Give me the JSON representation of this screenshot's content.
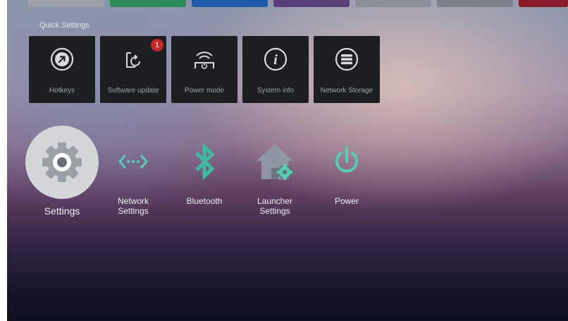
{
  "quick_settings": {
    "title": "Quick Settings",
    "tiles": [
      {
        "label": "Hotkeys",
        "icon": "arrow-up-right-circle-icon"
      },
      {
        "label": "Software update",
        "icon": "update-icon",
        "badge": "1"
      },
      {
        "label": "Power mode",
        "icon": "power-mode-icon"
      },
      {
        "label": "System info",
        "icon": "info-icon"
      },
      {
        "label": "Network Storage",
        "icon": "storage-icon"
      }
    ]
  },
  "apps": [
    {
      "label": "Settings",
      "icon": "gear-icon"
    },
    {
      "label_line1": "Network",
      "label_line2": "Settings",
      "icon": "network-arrows-icon"
    },
    {
      "label": "Bluetooth",
      "icon": "bluetooth-icon"
    },
    {
      "label_line1": "Launcher",
      "label_line2": "Settings",
      "icon": "launcher-settings-icon"
    },
    {
      "label": "Power",
      "icon": "power-icon"
    }
  ],
  "colors": {
    "accent_teal": "#58cdb6",
    "tile_bg": "#1d1e22",
    "badge_red": "#c1272d",
    "strip_colors": [
      "#9aa0a6",
      "#2e8b57",
      "#1e5aa8",
      "#5b3f7a",
      "#8a8f96",
      "#7c8088",
      "#8b1a2a"
    ]
  }
}
